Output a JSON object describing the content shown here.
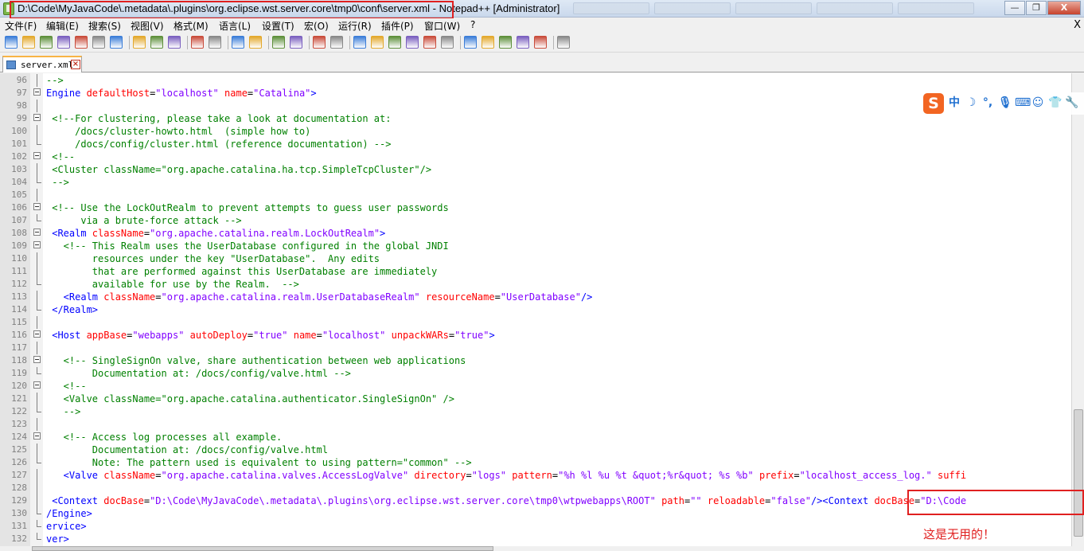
{
  "window": {
    "title": "D:\\Code\\MyJavaCode\\.metadata\\.plugins\\org.eclipse.wst.server.core\\tmp0\\conf\\server.xml - Notepad++ [Administrator]",
    "buttons": {
      "minimize": "—",
      "maximize": "❐",
      "close": "X"
    }
  },
  "menu": {
    "items": [
      "文件(F)",
      "编辑(E)",
      "搜索(S)",
      "视图(V)",
      "格式(M)",
      "语言(L)",
      "设置(T)",
      "宏(O)",
      "运行(R)",
      "插件(P)",
      "窗口(W)",
      "?"
    ],
    "close": "X"
  },
  "toolbar": {
    "icons": [
      "new-icon",
      "open-icon",
      "save-icon",
      "save-all-icon",
      "close-icon",
      "close-all-icon",
      "print-icon",
      "cut-icon",
      "copy-icon",
      "paste-icon",
      "undo-icon",
      "redo-icon",
      "find-icon",
      "replace-icon",
      "zoom-in-icon",
      "zoom-out-icon",
      "sync-v-icon",
      "sync-h-icon",
      "wrap-icon",
      "show-all-chars-icon",
      "indent-guide-icon",
      "udl-icon",
      "doc-map-icon",
      "function-list-icon",
      "record-macro-icon",
      "stop-macro-icon",
      "play-macro-icon",
      "run-macro-multiple-icon",
      "save-macro-icon",
      "spellcheck-icon"
    ]
  },
  "tab": {
    "label": "server.xml"
  },
  "editor": {
    "lines": [
      {
        "n": "96",
        "fold": "line",
        "segs": [
          [
            "cmt",
            "-->"
          ]
        ]
      },
      {
        "n": "97",
        "fold": "box",
        "segs": [
          [
            "tag",
            "Engine "
          ],
          [
            "attr",
            "defaultHost"
          ],
          [
            "text",
            "="
          ],
          [
            "val",
            "\"localhost\""
          ],
          [
            "text",
            " "
          ],
          [
            "attr",
            "name"
          ],
          [
            "text",
            "="
          ],
          [
            "val",
            "\"Catalina\""
          ],
          [
            "tag",
            ">"
          ]
        ]
      },
      {
        "n": "98",
        "fold": "line",
        "segs": []
      },
      {
        "n": "99",
        "fold": "box",
        "segs": [
          [
            "cmt",
            " <!--For clustering, please take a look at documentation at:"
          ]
        ]
      },
      {
        "n": "100",
        "fold": "line",
        "segs": [
          [
            "cmt",
            "     /docs/cluster-howto.html  (simple how to)"
          ]
        ]
      },
      {
        "n": "101",
        "fold": "end",
        "segs": [
          [
            "cmt",
            "     /docs/config/cluster.html (reference documentation) -->"
          ]
        ]
      },
      {
        "n": "102",
        "fold": "box",
        "segs": [
          [
            "cmt",
            " <!--"
          ]
        ]
      },
      {
        "n": "103",
        "fold": "line",
        "segs": [
          [
            "cmt",
            " <Cluster className=\"org.apache.catalina.ha.tcp.SimpleTcpCluster\"/>"
          ]
        ]
      },
      {
        "n": "104",
        "fold": "end",
        "segs": [
          [
            "cmt",
            " -->"
          ]
        ]
      },
      {
        "n": "105",
        "fold": "line",
        "segs": []
      },
      {
        "n": "106",
        "fold": "box",
        "segs": [
          [
            "cmt",
            " <!-- Use the LockOutRealm to prevent attempts to guess user passwords"
          ]
        ]
      },
      {
        "n": "107",
        "fold": "end",
        "segs": [
          [
            "cmt",
            "      via a brute-force attack -->"
          ]
        ]
      },
      {
        "n": "108",
        "fold": "box",
        "segs": [
          [
            "tag",
            " <Realm "
          ],
          [
            "attr",
            "className"
          ],
          [
            "text",
            "="
          ],
          [
            "val",
            "\"org.apache.catalina.realm.LockOutRealm\""
          ],
          [
            "tag",
            ">"
          ]
        ]
      },
      {
        "n": "109",
        "fold": "box",
        "segs": [
          [
            "cmt",
            "   <!-- This Realm uses the UserDatabase configured in the global JNDI"
          ]
        ]
      },
      {
        "n": "110",
        "fold": "line",
        "segs": [
          [
            "cmt",
            "        resources under the key \"UserDatabase\".  Any edits"
          ]
        ]
      },
      {
        "n": "111",
        "fold": "line",
        "segs": [
          [
            "cmt",
            "        that are performed against this UserDatabase are immediately"
          ]
        ]
      },
      {
        "n": "112",
        "fold": "end",
        "segs": [
          [
            "cmt",
            "        available for use by the Realm.  -->"
          ]
        ]
      },
      {
        "n": "113",
        "fold": "line",
        "segs": [
          [
            "tag",
            "   <Realm "
          ],
          [
            "attr",
            "className"
          ],
          [
            "text",
            "="
          ],
          [
            "val",
            "\"org.apache.catalina.realm.UserDatabaseRealm\""
          ],
          [
            "text",
            " "
          ],
          [
            "attr",
            "resourceName"
          ],
          [
            "text",
            "="
          ],
          [
            "val",
            "\"UserDatabase\""
          ],
          [
            "tag",
            "/>"
          ]
        ]
      },
      {
        "n": "114",
        "fold": "end",
        "segs": [
          [
            "tag",
            " </Realm>"
          ]
        ]
      },
      {
        "n": "115",
        "fold": "line",
        "segs": []
      },
      {
        "n": "116",
        "fold": "box",
        "segs": [
          [
            "tag",
            " <Host "
          ],
          [
            "attr",
            "appBase"
          ],
          [
            "text",
            "="
          ],
          [
            "val",
            "\"webapps\""
          ],
          [
            "text",
            " "
          ],
          [
            "attr",
            "autoDeploy"
          ],
          [
            "text",
            "="
          ],
          [
            "val",
            "\"true\""
          ],
          [
            "text",
            " "
          ],
          [
            "attr",
            "name"
          ],
          [
            "text",
            "="
          ],
          [
            "val",
            "\"localhost\""
          ],
          [
            "text",
            " "
          ],
          [
            "attr",
            "unpackWARs"
          ],
          [
            "text",
            "="
          ],
          [
            "val",
            "\"true\""
          ],
          [
            "tag",
            ">"
          ]
        ]
      },
      {
        "n": "117",
        "fold": "line",
        "segs": []
      },
      {
        "n": "118",
        "fold": "box",
        "segs": [
          [
            "cmt",
            "   <!-- SingleSignOn valve, share authentication between web applications"
          ]
        ]
      },
      {
        "n": "119",
        "fold": "end",
        "segs": [
          [
            "cmt",
            "        Documentation at: /docs/config/valve.html -->"
          ]
        ]
      },
      {
        "n": "120",
        "fold": "box",
        "segs": [
          [
            "cmt",
            "   <!--"
          ]
        ]
      },
      {
        "n": "121",
        "fold": "line",
        "segs": [
          [
            "cmt",
            "   <Valve className=\"org.apache.catalina.authenticator.SingleSignOn\" />"
          ]
        ]
      },
      {
        "n": "122",
        "fold": "end",
        "segs": [
          [
            "cmt",
            "   -->"
          ]
        ]
      },
      {
        "n": "123",
        "fold": "line",
        "segs": []
      },
      {
        "n": "124",
        "fold": "box",
        "segs": [
          [
            "cmt",
            "   <!-- Access log processes all example."
          ]
        ]
      },
      {
        "n": "125",
        "fold": "line",
        "segs": [
          [
            "cmt",
            "        Documentation at: /docs/config/valve.html"
          ]
        ]
      },
      {
        "n": "126",
        "fold": "end",
        "segs": [
          [
            "cmt",
            "        Note: The pattern used is equivalent to using pattern=\"common\" -->"
          ]
        ]
      },
      {
        "n": "127",
        "fold": "line",
        "segs": [
          [
            "tag",
            "   <Valve "
          ],
          [
            "attr",
            "className"
          ],
          [
            "text",
            "="
          ],
          [
            "val",
            "\"org.apache.catalina.valves.AccessLogValve\""
          ],
          [
            "text",
            " "
          ],
          [
            "attr",
            "directory"
          ],
          [
            "text",
            "="
          ],
          [
            "val",
            "\"logs\""
          ],
          [
            "text",
            " "
          ],
          [
            "attr",
            "pattern"
          ],
          [
            "text",
            "="
          ],
          [
            "val",
            "\"%h %l %u %t &quot;%r&quot; %s %b\""
          ],
          [
            "text",
            " "
          ],
          [
            "attr",
            "prefix"
          ],
          [
            "text",
            "="
          ],
          [
            "val",
            "\"localhost_access_log.\""
          ],
          [
            "text",
            " "
          ],
          [
            "attr",
            "suffi"
          ]
        ]
      },
      {
        "n": "128",
        "fold": "line",
        "segs": []
      },
      {
        "n": "129",
        "fold": "line",
        "segs": [
          [
            "tag",
            " <Context "
          ],
          [
            "attr",
            "docBase"
          ],
          [
            "text",
            "="
          ],
          [
            "val",
            "\"D:\\Code\\MyJavaCode\\.metadata\\.plugins\\org.eclipse.wst.server.core\\tmp0\\wtpwebapps\\ROOT\""
          ],
          [
            "text",
            " "
          ],
          [
            "attr",
            "path"
          ],
          [
            "text",
            "="
          ],
          [
            "val",
            "\"\""
          ],
          [
            "text",
            " "
          ],
          [
            "attr",
            "reloadable"
          ],
          [
            "text",
            "="
          ],
          [
            "val",
            "\"false\""
          ],
          [
            "tag",
            "/>"
          ],
          [
            "tag",
            "<Context "
          ],
          [
            "attr",
            "docBase"
          ],
          [
            "text",
            "="
          ],
          [
            "val",
            "\"D:\\Code"
          ]
        ]
      },
      {
        "n": "130",
        "fold": "end",
        "segs": [
          [
            "tag",
            "/Engine>"
          ]
        ]
      },
      {
        "n": "131",
        "fold": "end",
        "segs": [
          [
            "tag",
            "ervice>"
          ]
        ]
      },
      {
        "n": "132",
        "fold": "end",
        "segs": [
          [
            "tag",
            "ver>"
          ]
        ]
      }
    ]
  },
  "ime": {
    "logo": "S",
    "items": [
      "中",
      "☽",
      "°,",
      "🎙",
      "⌨",
      "☺",
      "👕",
      "🔧"
    ]
  },
  "annotation": {
    "text": "这是无用的！"
  },
  "colors": {
    "tag": "#0000ff",
    "attr": "#ff0000",
    "val": "#8000ff",
    "comment": "#008000",
    "highlight": "#e02020"
  }
}
